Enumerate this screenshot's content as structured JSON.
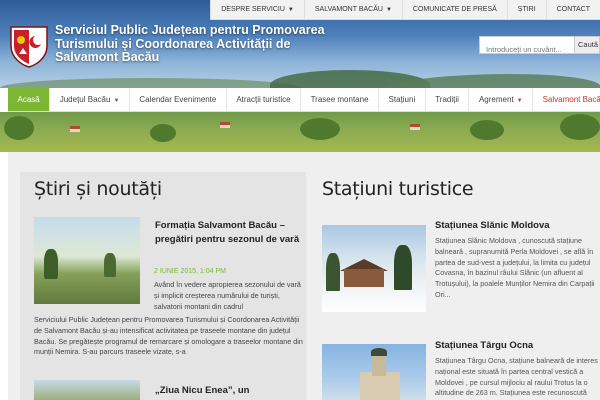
{
  "colors": {
    "accent": "#7cb733",
    "brand_red": "#c0392b",
    "header_blue": "#3a6aa6"
  },
  "header": {
    "title": "Serviciul Public Județean pentru Promovarea Turismului și Coordonarea Activității de Salvamont Bacău",
    "logo_icon": "county-coat-of-arms"
  },
  "topnav": {
    "items": [
      {
        "label": "DESPRE SERVICIU",
        "dropdown": true
      },
      {
        "label": "SALVAMONT BACĂU",
        "dropdown": true
      },
      {
        "label": "COMUNICATE DE PRESĂ",
        "dropdown": false
      },
      {
        "label": "ȘTIRI",
        "dropdown": false
      },
      {
        "label": "CONTACT",
        "dropdown": false
      }
    ]
  },
  "search": {
    "placeholder": "Introduceți un cuvânt...",
    "button_label": "Caută"
  },
  "mainnav": {
    "items": [
      {
        "label": "Acasă",
        "active": true,
        "dropdown": false
      },
      {
        "label": "Județul Bacău",
        "dropdown": true
      },
      {
        "label": "Calendar Evenimente",
        "dropdown": false
      },
      {
        "label": "Atracții turistice",
        "dropdown": false
      },
      {
        "label": "Trasee montane",
        "dropdown": false
      },
      {
        "label": "Stațiuni",
        "dropdown": false
      },
      {
        "label": "Tradiții",
        "dropdown": false
      },
      {
        "label": "Agrement",
        "dropdown": true
      },
      {
        "label": "Salvamont Bacău",
        "dropdown": false,
        "highlight": true
      }
    ]
  },
  "news": {
    "section_title": "Știri și noutăți",
    "items": [
      {
        "title": "Formația Salvamont Bacău – pregătiri pentru sezonul de vară",
        "date": "2 IUNIE 2015, 1:04 PM",
        "excerpt_right": "Având în vedere apropierea sezonului de vară și implicit creșterea numărului de turiști, salvatorii montani din cadrul",
        "excerpt_full": "Serviciului Public Județean pentru Promovarea Turismului și Coordonarea Activității de Salvamont Bacău și-au intensificat activitatea pe traseele montane din județul Bacău. Se pregătește programul de remarcare și omologare a traseelor montane din munții Nemira. S-au parcurs traseele vizate, s-a"
      },
      {
        "title": "„Ziua Nicu Enea”, un"
      }
    ]
  },
  "resorts": {
    "section_title": "Stațiuni turistice",
    "items": [
      {
        "title": "Stațiunea Slănic Moldova",
        "text": "Stațiunea Slănic Moldova , cunoscută stațiune balneară , supranumită Perla Moldovei , se află în partea de sud-vest a județului, la limita cu județul Covasna, în bazinul râului Slănic (un afluent al Trotușului), la poalele Munților Nemira din Carpații Ori..."
      },
      {
        "title": "Stațiunea Târgu Ocna",
        "text": "Stațiunea Târgu Ocna, stațiune balneară de interes național este situată în partea central vestică a Moldovei , pe cursul mijlociu al raului Trotus la o altitudine de 263 m. Stațiunea este recunoscută"
      }
    ]
  }
}
